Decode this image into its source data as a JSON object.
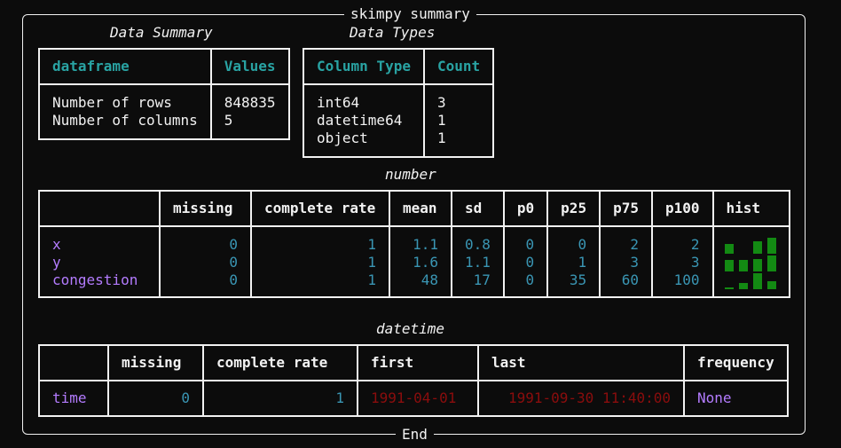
{
  "frame": {
    "title": "skimpy summary",
    "footer": "End"
  },
  "data_summary": {
    "caption": "Data Summary",
    "headers": [
      "dataframe",
      "Values"
    ],
    "rows": [
      [
        "Number of rows",
        "848835"
      ],
      [
        "Number of columns",
        "5"
      ]
    ]
  },
  "data_types": {
    "caption": "Data Types",
    "headers": [
      "Column Type",
      "Count"
    ],
    "rows": [
      [
        "int64",
        "3"
      ],
      [
        "datetime64",
        "1"
      ],
      [
        "object",
        "1"
      ]
    ]
  },
  "number": {
    "caption": "number",
    "headers": [
      "",
      "missing",
      "complete rate",
      "mean",
      "sd",
      "p0",
      "p25",
      "p75",
      "p100",
      "hist"
    ],
    "rows": [
      {
        "name": "x",
        "missing": "0",
        "complete_rate": "1",
        "mean": "1.1",
        "sd": "0.8",
        "p0": "0",
        "p25": "0",
        "p75": "2",
        "p100": "2",
        "hist": [
          0.6,
          0,
          0.8,
          1.0
        ]
      },
      {
        "name": "y",
        "missing": "0",
        "complete_rate": "1",
        "mean": "1.6",
        "sd": "1.1",
        "p0": "0",
        "p25": "1",
        "p75": "3",
        "p100": "3",
        "hist": [
          0.7,
          0.7,
          0.8,
          1.0
        ]
      },
      {
        "name": "congestion",
        "missing": "0",
        "complete_rate": "1",
        "mean": "48",
        "sd": "17",
        "p0": "0",
        "p25": "35",
        "p75": "60",
        "p100": "100",
        "hist": [
          0.1,
          0.4,
          1.0,
          0.5
        ]
      }
    ]
  },
  "datetime": {
    "caption": "datetime",
    "headers": [
      "",
      "missing",
      "complete rate",
      "first",
      "last",
      "frequency"
    ],
    "rows": [
      {
        "name": "time",
        "missing": "0",
        "complete_rate": "1",
        "first": "1991-04-01",
        "last": "1991-09-30 11:40:00",
        "frequency": "None"
      }
    ]
  },
  "colors": {
    "background": "#0c0c0c",
    "header_teal": "#29a3a3",
    "value_teal": "#3a96b4",
    "name_purple": "#b47cff",
    "date_red": "#8b0d0d",
    "hist_green": "#138a13"
  }
}
